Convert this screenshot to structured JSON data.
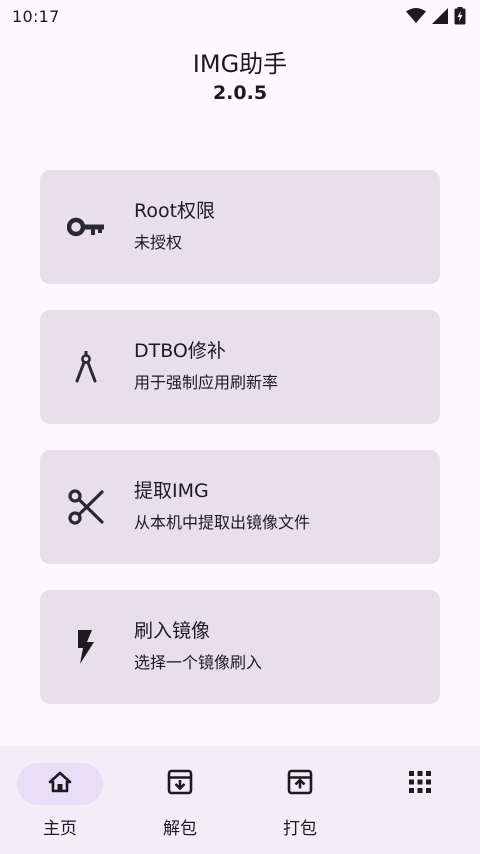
{
  "status_bar": {
    "time": "10:17",
    "icons": [
      "wifi-icon",
      "signal-icon",
      "battery-charging-icon"
    ]
  },
  "header": {
    "title": "IMG助手",
    "version": "2.0.5"
  },
  "cards": [
    {
      "icon": "key-icon",
      "title": "Root权限",
      "subtitle": "未授权"
    },
    {
      "icon": "compass-icon",
      "title": "DTBO修补",
      "subtitle": "用于强制应用刷新率"
    },
    {
      "icon": "scissors-icon",
      "title": "提取IMG",
      "subtitle": "从本机中提取出镜像文件"
    },
    {
      "icon": "flash-icon",
      "title": "刷入镜像",
      "subtitle": "选择一个镜像刷入"
    }
  ],
  "bottom_nav": {
    "items": [
      {
        "icon": "home-icon",
        "label": "主页",
        "active": true
      },
      {
        "icon": "unarchive-box-icon",
        "label": "解包",
        "active": false
      },
      {
        "icon": "archive-box-icon",
        "label": "打包",
        "active": false
      },
      {
        "icon": "apps-grid-icon",
        "label": "",
        "active": false
      }
    ]
  },
  "colors": {
    "background": "#fdf8fd",
    "card": "#e7e0eb",
    "nav_bar": "#f3edf7",
    "nav_active_pill": "#e8def8",
    "text": "#1c1b1f"
  }
}
